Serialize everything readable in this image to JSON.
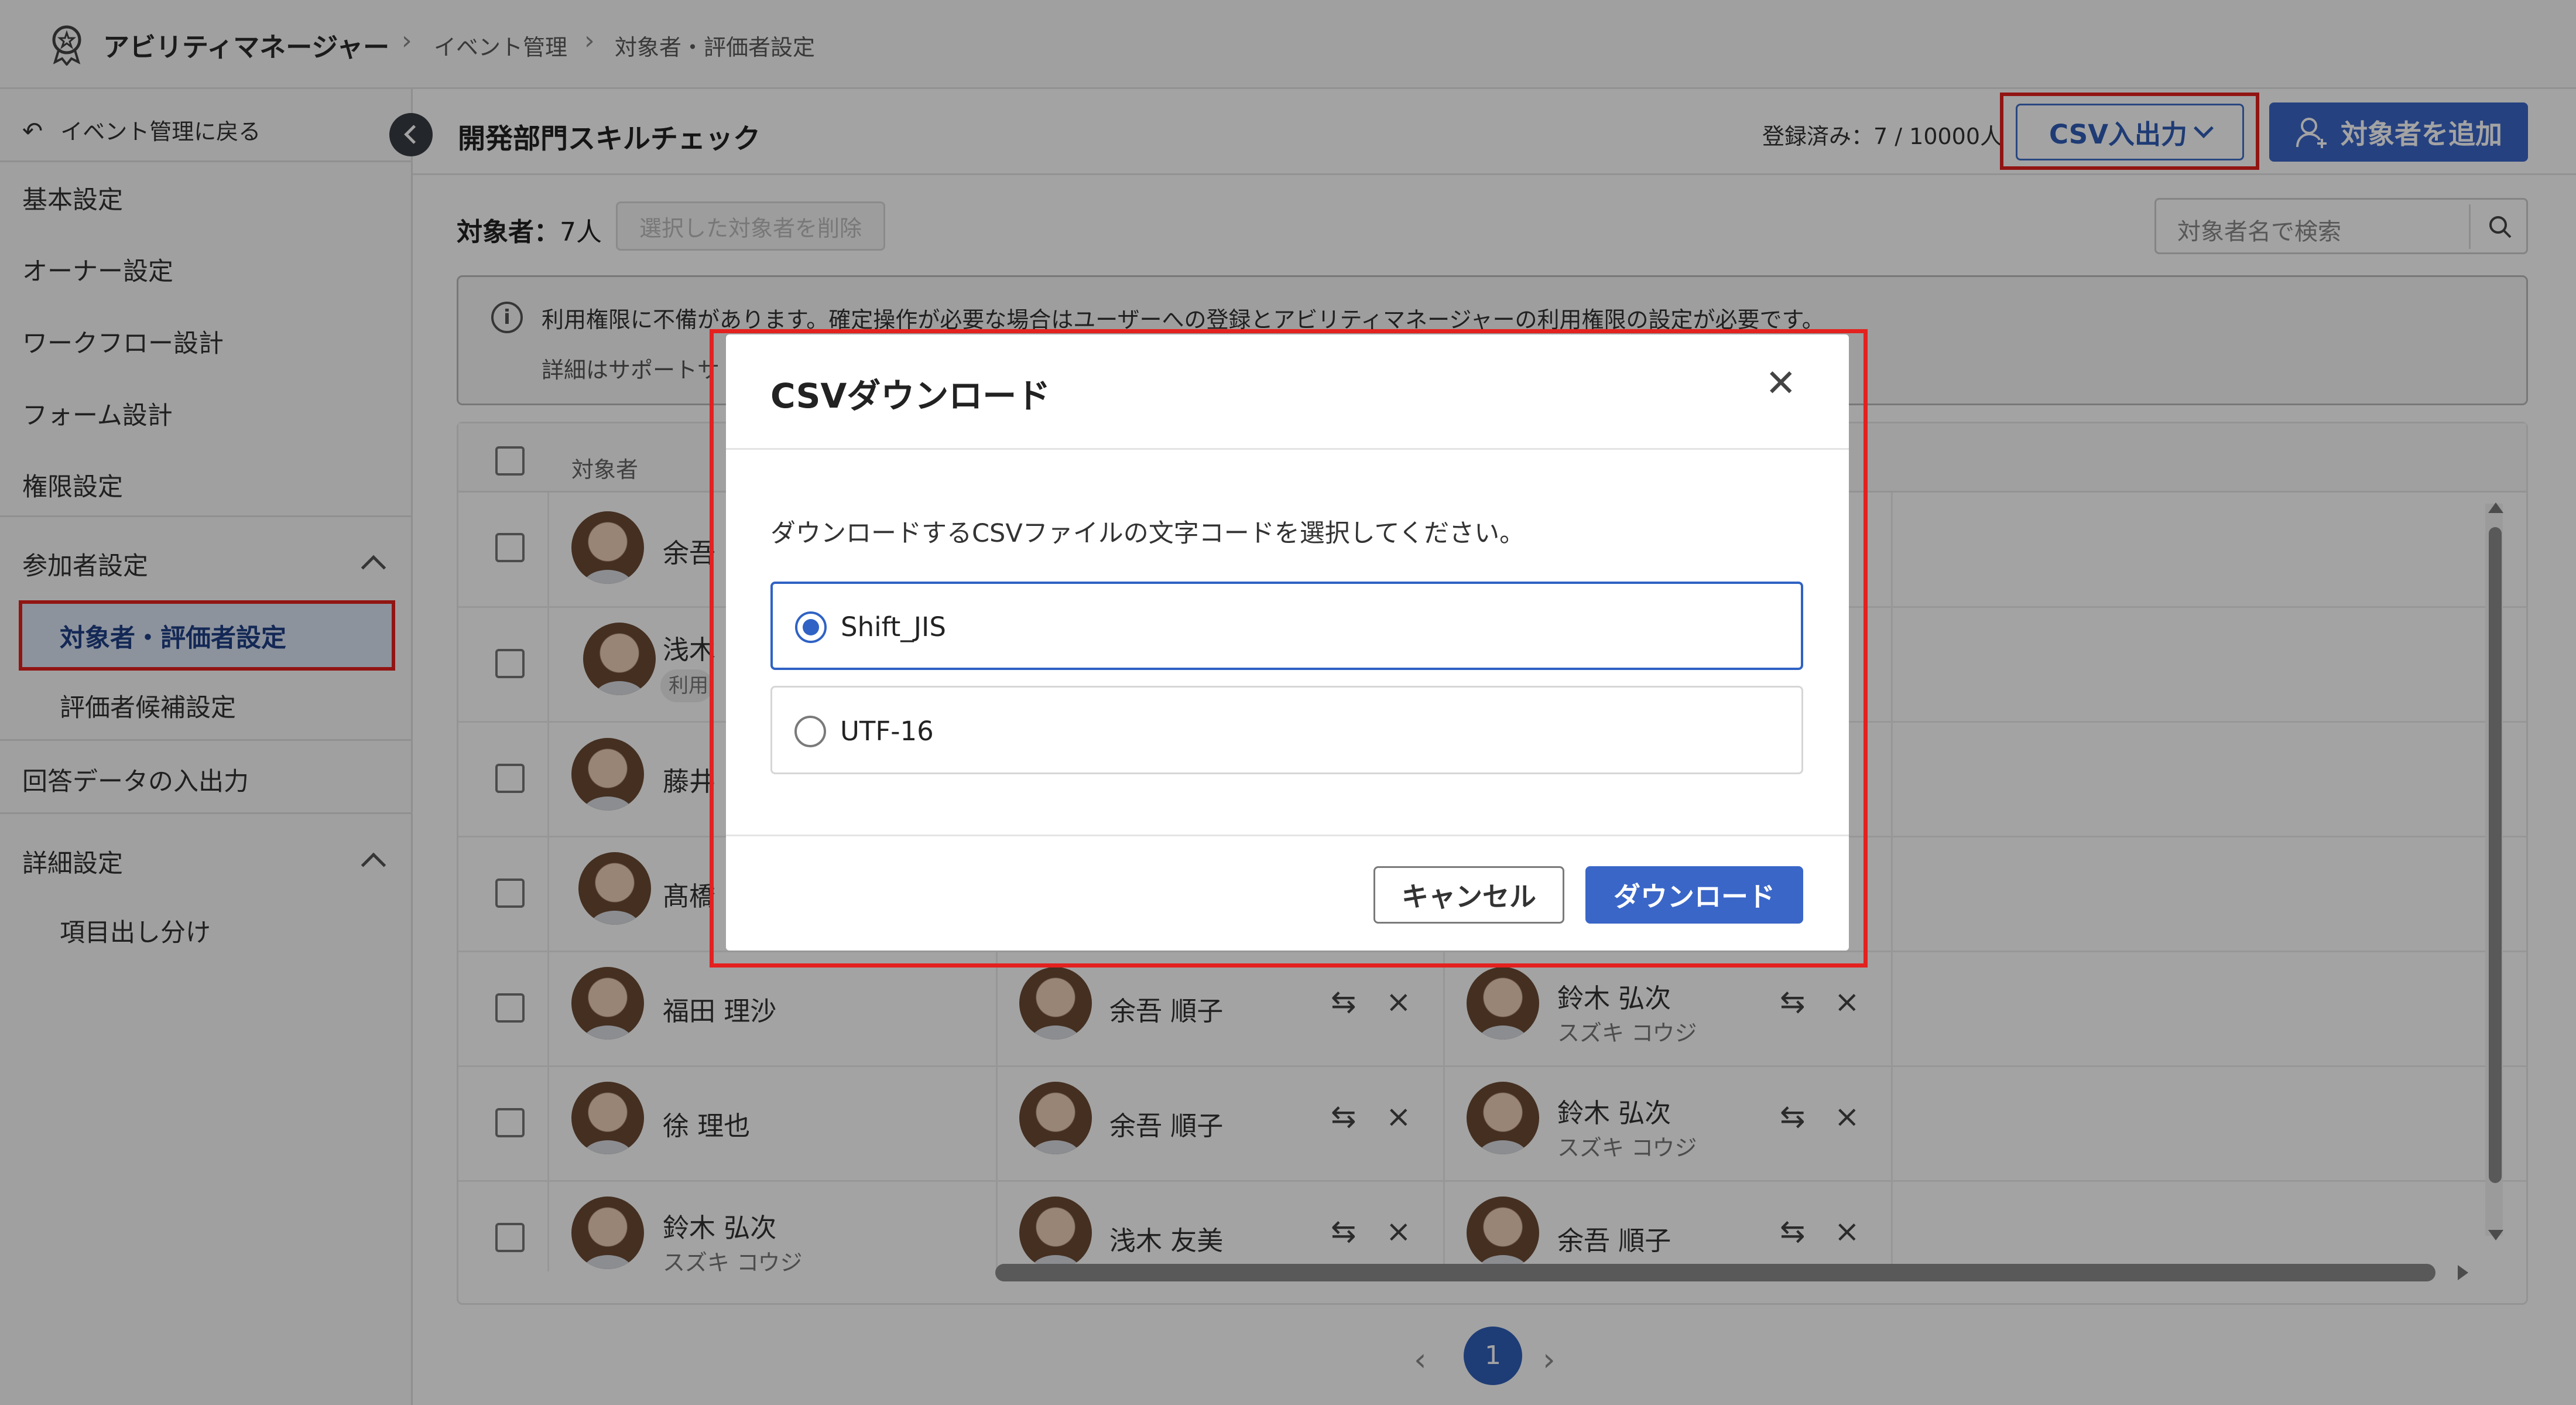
{
  "header": {
    "app_title": "アビリティマネージャー",
    "breadcrumbs": [
      "イベント管理",
      "対象者・評価者設定"
    ]
  },
  "sidebar": {
    "back_label": "イベント管理に戻る",
    "items": [
      {
        "label": "基本設定"
      },
      {
        "label": "オーナー設定"
      },
      {
        "label": "ワークフロー設計"
      },
      {
        "label": "フォーム設計"
      },
      {
        "label": "権限設定"
      },
      {
        "label": "参加者設定"
      },
      {
        "label": "対象者・評価者設定"
      },
      {
        "label": "評価者候補設定"
      },
      {
        "label": "回答データの入出力"
      },
      {
        "label": "詳細設定"
      },
      {
        "label": "項目出し分け"
      }
    ]
  },
  "page": {
    "title": "開発部門スキルチェック",
    "registered": "登録済み：7 / 10000人",
    "csv_button": "CSV入出力",
    "add_button": "対象者を追加",
    "target_label": "対象者：",
    "target_count": "7人",
    "delete_button": "選択した対象者を削除",
    "search_placeholder": "対象者名で検索",
    "notice_text": "利用権限に不備があります。確定操作が必要な場合はユーザーへの登録とアビリティマネージャーの利用権限の設定が必要です。",
    "notice_sub": "詳細はサポートサ",
    "col_target": "対象者",
    "badge_label": "利用"
  },
  "table": {
    "rows": [
      {
        "target": "余吾",
        "kana": ""
      },
      {
        "target": "浅木",
        "kana": ""
      },
      {
        "target": "藤井",
        "kana": ""
      },
      {
        "target": "髙橋",
        "kana": ""
      },
      {
        "target": "福田 理沙",
        "kana": "",
        "eval1": "余吾 順子",
        "eval2": "鈴木 弘次",
        "eval2_kana": "スズキ コウジ"
      },
      {
        "target": "徐 理也",
        "kana": "",
        "eval1": "余吾 順子",
        "eval2": "鈴木 弘次",
        "eval2_kana": "スズキ コウジ"
      },
      {
        "target": "鈴木 弘次",
        "kana": "スズキ コウジ",
        "eval1": "浅木 友美",
        "eval2": "余吾 順子"
      }
    ]
  },
  "pagination": {
    "current": "1"
  },
  "modal": {
    "title": "CSVダウンロード",
    "description": "ダウンロードするCSVファイルの文字コードを選択してください。",
    "options": [
      {
        "label": "Shift_JIS",
        "selected": true
      },
      {
        "label": "UTF-16",
        "selected": false
      }
    ],
    "cancel": "キャンセル",
    "download": "ダウンロード"
  },
  "colors": {
    "accent": "#3a66c8",
    "highlight": "#e3211f"
  }
}
